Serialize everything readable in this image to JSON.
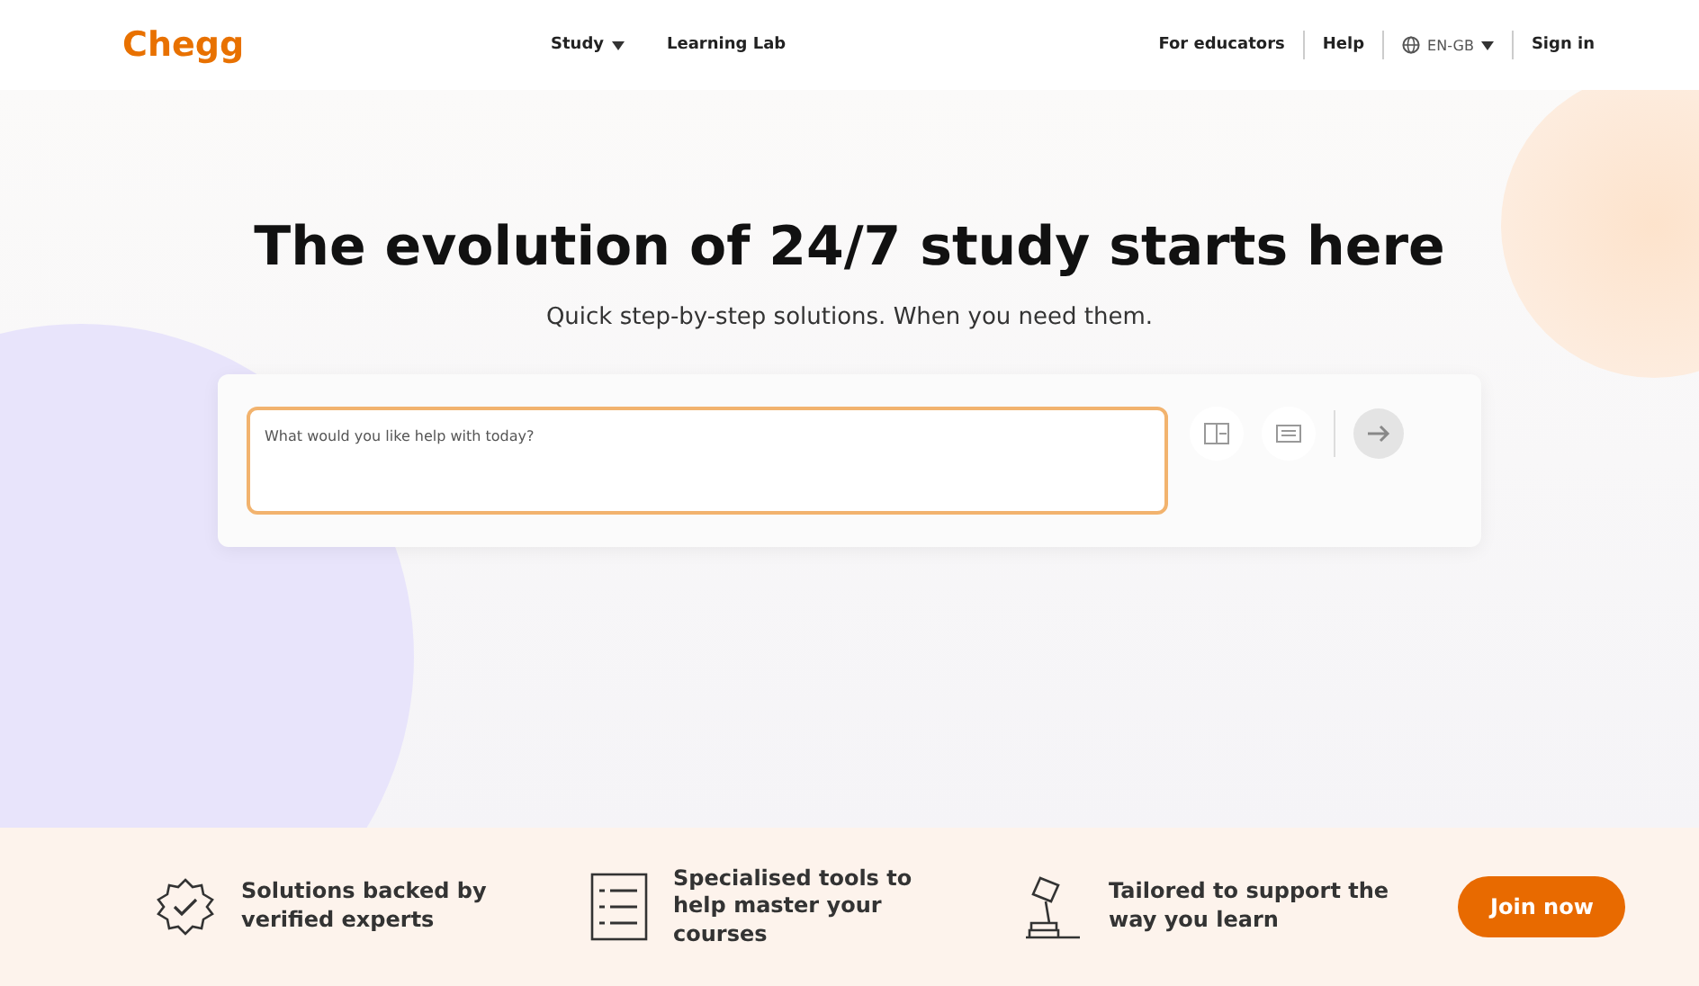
{
  "header": {
    "logo": "Chegg",
    "nav": [
      {
        "label": "Study",
        "dropdown": true
      },
      {
        "label": "Learning Lab",
        "dropdown": false
      }
    ],
    "links": [
      {
        "kind": "link",
        "label": "For educators"
      },
      {
        "kind": "link",
        "label": "Help"
      },
      {
        "kind": "language",
        "label": "EN-GB"
      },
      {
        "kind": "link",
        "label": "Sign in"
      }
    ]
  },
  "hero": {
    "title": "The evolution of 24/7 study starts here",
    "subtitle": "Quick step-by-step solutions. When you need them.",
    "search": {
      "placeholder": "What would you like help with today?"
    }
  },
  "features": [
    {
      "kind": "badge",
      "text": "Solutions backed by verified experts"
    },
    {
      "kind": "list",
      "text": "Specialised tools to help master your courses"
    },
    {
      "kind": "lamp",
      "text": "Tailored to support the way you learn"
    }
  ],
  "cta": "Join now"
}
